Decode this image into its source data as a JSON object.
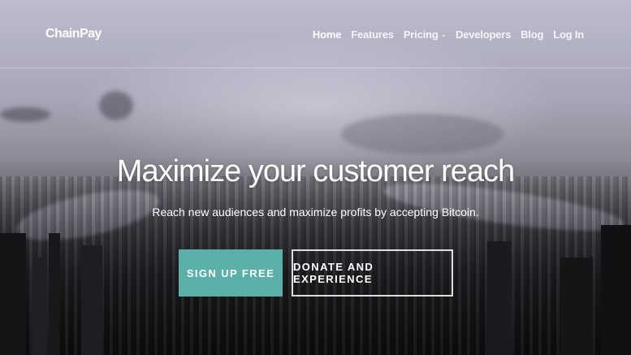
{
  "brand": {
    "name": "ChainPay"
  },
  "nav": {
    "items": [
      {
        "label": "Home",
        "active": true
      },
      {
        "label": "Features"
      },
      {
        "label": "Pricing",
        "dropdown": true,
        "icon": "chevron-down-icon"
      },
      {
        "label": "Developers"
      },
      {
        "label": "Blog"
      },
      {
        "label": "Log In"
      }
    ]
  },
  "hero": {
    "headline": "Maximize your customer reach",
    "subheadline": "Reach new audiences and maximize profits by accepting Bitcoin.",
    "primary_cta": "SIGN UP FREE",
    "secondary_cta": "DONATE AND EXPERIENCE"
  },
  "colors": {
    "accent": "#5bb0a9",
    "text": "#ffffff"
  }
}
